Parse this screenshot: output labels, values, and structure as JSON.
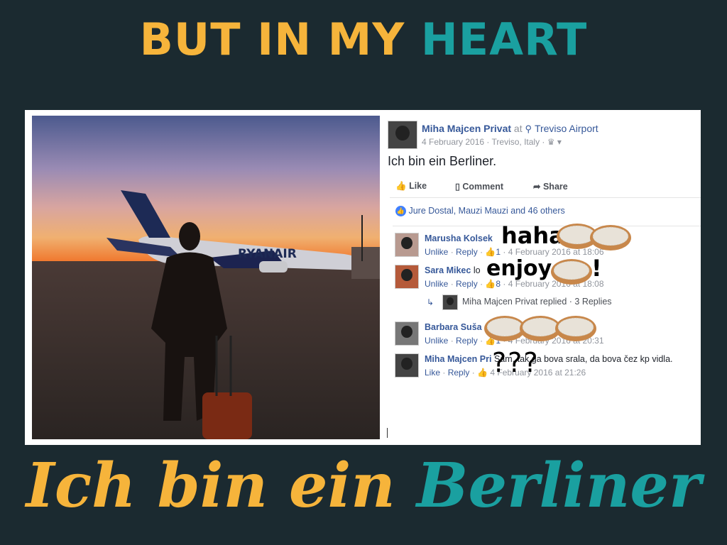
{
  "headline": {
    "part1": "BUT IN MY ",
    "part2": "HEART"
  },
  "post": {
    "author": "Miha Majcen Privat",
    "at": " at ",
    "location": "Treviso Airport",
    "date": "4 February 2016",
    "place": " · Treviso, Italy · ",
    "text": "Ich bin ein Berliner.",
    "actions": {
      "like": "Like",
      "comment": "Comment",
      "share": "Share"
    },
    "reactions": "Jure Dostal, Mauzi Mauzi and 46 others"
  },
  "comments": [
    {
      "name": "Marusha Kolsek",
      "text": "",
      "unlike": "Unlike",
      "reply": "Reply",
      "count": "1",
      "time": "4 February 2016 at 18:06"
    },
    {
      "name": "Sara Mikec",
      "text": "lo",
      "unlike": "Unlike",
      "reply": "Reply",
      "count": "8",
      "time": "4 February 2016 at 18:08"
    },
    {
      "name": "Barbara Suša",
      "text": "",
      "unlike": "Unlike",
      "reply": "Reply",
      "count": "1",
      "time": "4 February 2016 at 20:31"
    },
    {
      "name": "Miha Majcen Pri",
      "text": "Sam, tak ga bova srala, da bova čez kp vidla.",
      "unlike": "Like",
      "reply": "Reply",
      "count": "",
      "time": "4 February 2016 at 21:26"
    }
  ],
  "reply_summary": {
    "name": "Miha Majcen Privat",
    "text": " replied · 3 Replies"
  },
  "overlays": {
    "haha": "haha",
    "enjoy": "enjoy",
    "bang": "!",
    "qqq": "???"
  },
  "photo": {
    "airline": "RYANAIR"
  },
  "footer": {
    "part1": "Ich bin ein ",
    "part2": "Berliner"
  },
  "colors": {
    "background": "#1b2a30",
    "yellow": "#f6b43b",
    "teal": "#1aa0a0",
    "fb_blue": "#365899"
  }
}
